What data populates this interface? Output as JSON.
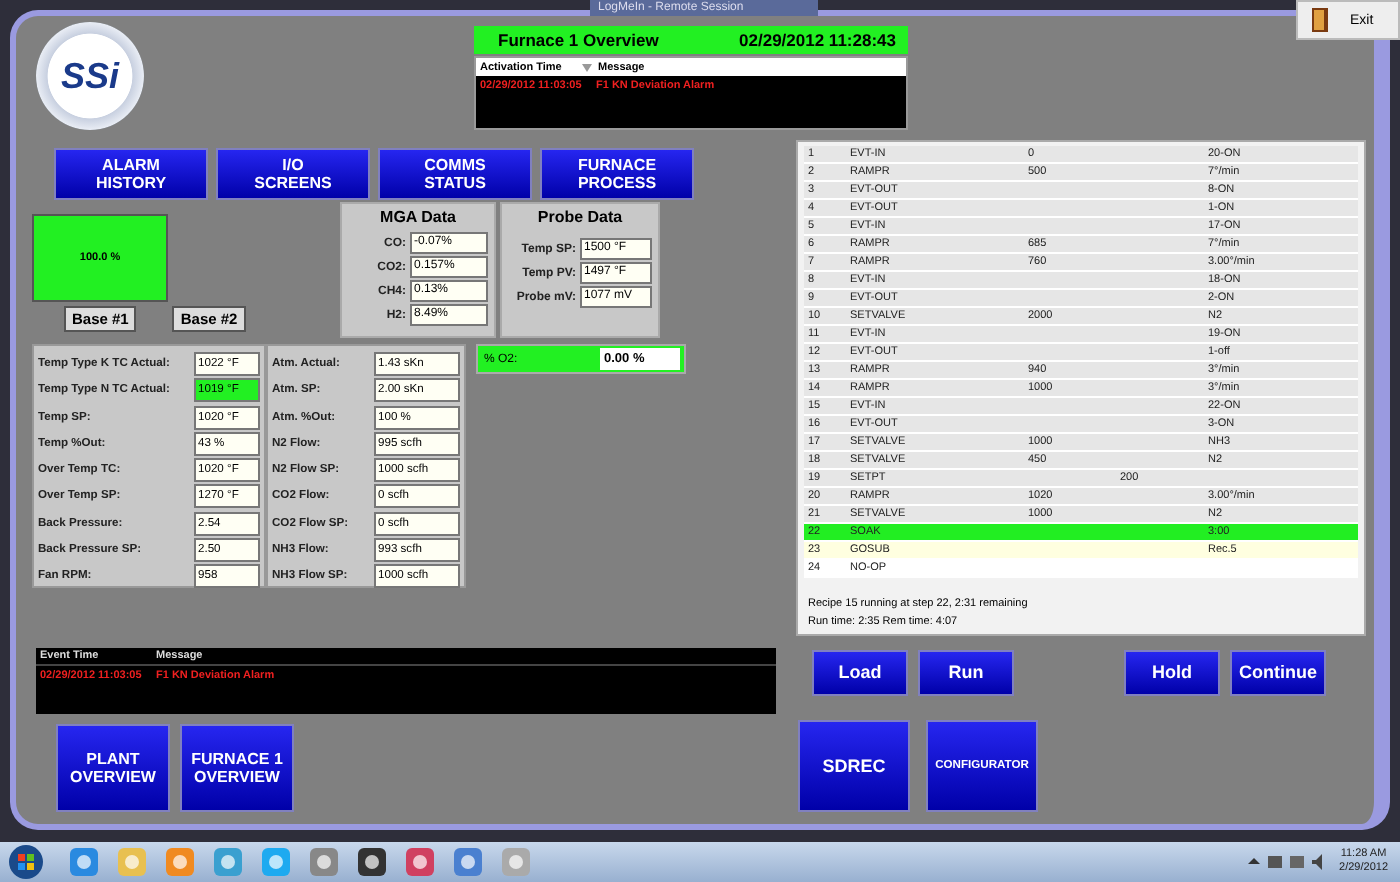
{
  "remote_tab": {
    "title": "LogMeIn - Remote Session"
  },
  "exit_button": {
    "label": "Exit"
  },
  "logo": {
    "text": "SSi"
  },
  "header": {
    "title": "Furnace 1 Overview",
    "datetime": "02/29/2012 11:28:43"
  },
  "alarm_list": {
    "columns": [
      "Activation Time",
      "Message"
    ],
    "rows": [
      {
        "time": "02/29/2012 11:03:05",
        "message": "F1 KN Deviation Alarm"
      }
    ]
  },
  "nav_buttons": [
    {
      "lines": [
        "ALARM",
        "HISTORY"
      ]
    },
    {
      "lines": [
        "I/O",
        "SCREENS"
      ]
    },
    {
      "lines": [
        "COMMS",
        "STATUS"
      ]
    },
    {
      "lines": [
        "FURNACE",
        "PROCESS"
      ]
    }
  ],
  "output_meter": {
    "reading": "100.0 %",
    "level": 1.0
  },
  "base_labels": [
    "Base #1",
    "Base #2"
  ],
  "mga": {
    "title": "MGA Data",
    "rows": [
      {
        "label": "CO:",
        "value": "-0.07%"
      },
      {
        "label": "CO2:",
        "value": "0.157%"
      },
      {
        "label": "CH4:",
        "value": "0.13%"
      },
      {
        "label": "H2:",
        "value": "8.49%"
      }
    ]
  },
  "probe": {
    "title": "Probe Data",
    "rows": [
      {
        "label": "Temp SP:",
        "value": "1500 °F"
      },
      {
        "label": "Temp PV:",
        "value": "1497 °F"
      },
      {
        "label": "Probe mV:",
        "value": "1077 mV"
      }
    ]
  },
  "o2": {
    "label": "% O2:",
    "value": "0.00 %"
  },
  "base1": {
    "rows": [
      {
        "label": "Temp Type K TC Actual:",
        "value": "1022 °F",
        "highlighted": false
      },
      {
        "label": "Temp Type N TC Actual:",
        "value": "1019 °F",
        "highlighted": true
      },
      {
        "label": "Temp SP:",
        "value": "1020 °F",
        "highlighted": false
      },
      {
        "label": "Temp %Out:",
        "value": "43 %",
        "highlighted": false
      },
      {
        "label": "Over Temp TC:",
        "value": "1020 °F",
        "highlighted": false
      },
      {
        "label": "Over Temp SP:",
        "value": "1270 °F",
        "highlighted": false
      },
      {
        "label": "Back Pressure:",
        "value": "2.54",
        "highlighted": false
      },
      {
        "label": "Back Pressure SP:",
        "value": "2.50",
        "highlighted": false
      },
      {
        "label": "Fan RPM:",
        "value": "958",
        "highlighted": false
      }
    ]
  },
  "base2": {
    "rows": [
      {
        "label": "Atm. Actual:",
        "value": "1.43 sKn",
        "highlighted": false
      },
      {
        "label": "Atm. SP:",
        "value": "2.00 sKn",
        "highlighted": false
      },
      {
        "label": "Atm. %Out:",
        "value": "100 %",
        "highlighted": false
      },
      {
        "label": "N2 Flow:",
        "value": "995 scfh",
        "highlighted": false
      },
      {
        "label": "N2 Flow SP:",
        "value": "1000 scfh",
        "highlighted": false
      },
      {
        "label": "CO2 Flow:",
        "value": "0 scfh",
        "highlighted": false
      },
      {
        "label": "CO2 Flow SP:",
        "value": "0 scfh",
        "highlighted": false
      },
      {
        "label": "NH3 Flow:",
        "value": "993 scfh",
        "highlighted": false
      },
      {
        "label": "NH3 Flow SP:",
        "value": "1000 scfh",
        "highlighted": false
      }
    ]
  },
  "event_log": {
    "columns": [
      "Event Time",
      "Message"
    ],
    "rows": [
      {
        "time": "02/29/2012 11:03:05",
        "message": "F1 KN Deviation Alarm"
      }
    ]
  },
  "bottom_buttons": [
    {
      "lines": [
        "PLANT",
        "OVERVIEW"
      ]
    },
    {
      "lines": [
        "FURNACE 1",
        "OVERVIEW"
      ]
    }
  ],
  "recipe": {
    "rows": [
      {
        "step": "1",
        "opcode": "EVT-IN",
        "value": "0",
        "detail": "20-ON",
        "kind": "done"
      },
      {
        "step": "2",
        "opcode": "RAMPR",
        "value": "500",
        "detail": "7°/min",
        "kind": "done"
      },
      {
        "step": "3",
        "opcode": "EVT-OUT",
        "detail": "8-ON",
        "kind": "done"
      },
      {
        "step": "4",
        "opcode": "EVT-OUT",
        "detail": "1-ON",
        "kind": "done"
      },
      {
        "step": "5",
        "opcode": "EVT-IN",
        "detail": "17-ON",
        "kind": "done"
      },
      {
        "step": "6",
        "opcode": "RAMPR",
        "value": "685",
        "detail": "7°/min",
        "kind": "done"
      },
      {
        "step": "7",
        "opcode": "RAMPR",
        "value": "760",
        "detail": "3.00°/min",
        "kind": "done"
      },
      {
        "step": "8",
        "opcode": "EVT-IN",
        "detail": "18-ON",
        "kind": "done"
      },
      {
        "step": "9",
        "opcode": "EVT-OUT",
        "detail": "2-ON",
        "kind": "done"
      },
      {
        "step": "10",
        "opcode": "SETVALVE",
        "value": "2000",
        "detail": "N2",
        "kind": "done"
      },
      {
        "step": "11",
        "opcode": "EVT-IN",
        "detail": "19-ON",
        "kind": "done"
      },
      {
        "step": "12",
        "opcode": "EVT-OUT",
        "detail": "1-off",
        "kind": "done"
      },
      {
        "step": "13",
        "opcode": "RAMPR",
        "value": "940",
        "detail": "3°/min",
        "kind": "done"
      },
      {
        "step": "14",
        "opcode": "RAMPR",
        "value": "1000",
        "detail": "3°/min",
        "kind": "done"
      },
      {
        "step": "15",
        "opcode": "EVT-IN",
        "detail": "22-ON",
        "kind": "done"
      },
      {
        "step": "16",
        "opcode": "EVT-OUT",
        "detail": "3-ON",
        "kind": "done"
      },
      {
        "step": "17",
        "opcode": "SETVALVE",
        "value": "1000",
        "detail": "NH3",
        "kind": "done"
      },
      {
        "step": "18",
        "opcode": "SETVALVE",
        "value": "450",
        "detail": "N2",
        "kind": "done"
      },
      {
        "step": "19",
        "opcode": "SETPT",
        "setpoint": "200",
        "kind": "done"
      },
      {
        "step": "20",
        "opcode": "RAMPR",
        "value": "1020",
        "detail": "3.00°/min",
        "kind": "done"
      },
      {
        "step": "21",
        "opcode": "SETVALVE",
        "value": "1000",
        "detail": "N2",
        "kind": "done"
      },
      {
        "step": "22",
        "opcode": "SOAK",
        "detail": "3:00",
        "kind": "active"
      },
      {
        "step": "23",
        "opcode": "GOSUB",
        "detail": "Rec.5",
        "kind": "next"
      },
      {
        "step": "24",
        "opcode": "NO-OP",
        "kind": "pending"
      }
    ],
    "status_lines": [
      "Recipe 15 running at step 22, 2:31 remaining",
      "Run time: 2:35 Rem time: 4:07"
    ]
  },
  "recipe_buttons": [
    "Load",
    "Run",
    "Hold",
    "Continue"
  ],
  "tool_buttons": [
    {
      "label": "SDREC",
      "kind": "large"
    },
    {
      "label": "CONFIGURATOR",
      "kind": "small"
    }
  ],
  "taskbar": {
    "time": "11:28 AM",
    "date": "2/29/2012"
  }
}
